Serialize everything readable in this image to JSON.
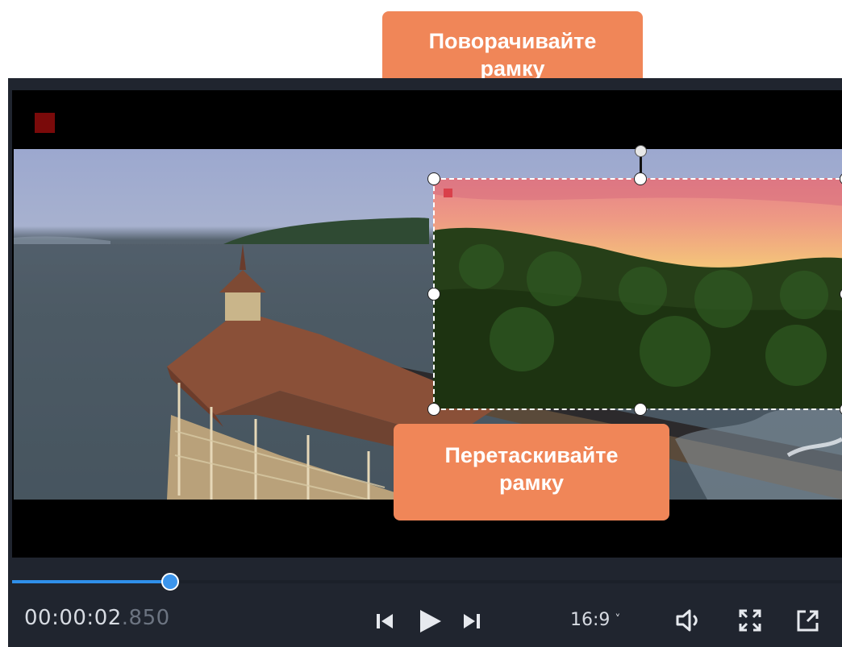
{
  "callouts": {
    "rotate": {
      "line1": "Поворачивайте",
      "line2": "рамку"
    },
    "drag": {
      "line1": "Перетаскивайте",
      "line2": "рамку"
    }
  },
  "player": {
    "timecode_main": "00:00:02",
    "timecode_ms": ".850",
    "aspect_ratio": "16:9",
    "aspect_chevron": "˅",
    "playback_progress_percent": 19
  },
  "icons": [
    "skip-back-icon",
    "play-icon",
    "skip-forward-icon",
    "chevron-down-icon",
    "volume-icon",
    "fullscreen-icon",
    "detach-window-icon"
  ],
  "colors": {
    "callout": "#f08658",
    "progress": "#2f8fea",
    "player_bg": "#20252f",
    "record_mark": "#7a0a0a",
    "pip_mark": "#d9404a"
  }
}
